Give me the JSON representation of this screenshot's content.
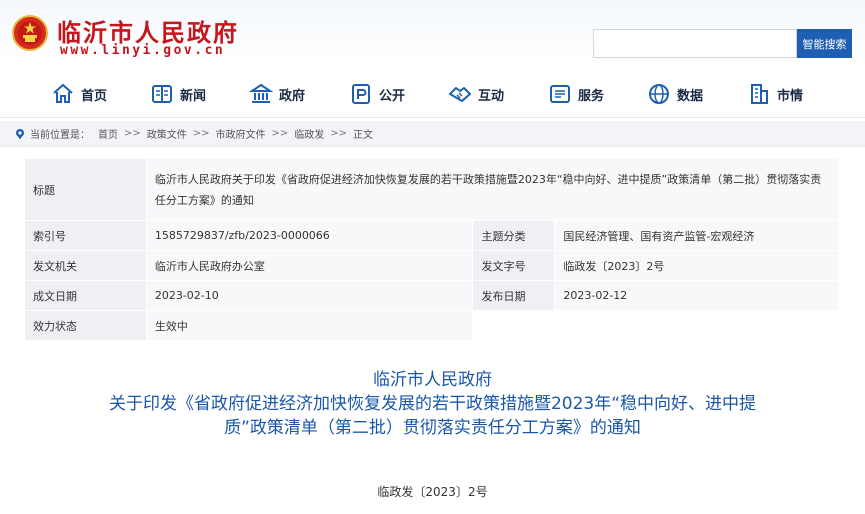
{
  "header": {
    "site_name": "临沂市人民政府",
    "site_url": "www.linyi.gov.cn",
    "search_placeholder": "",
    "search_button": "智能搜索",
    "brand_color": "#c4161c"
  },
  "nav": {
    "items": [
      {
        "label": "首页",
        "icon": "home-icon"
      },
      {
        "label": "新闻",
        "icon": "news-icon"
      },
      {
        "label": "政府",
        "icon": "government-building-icon"
      },
      {
        "label": "公开",
        "icon": "disclosure-icon"
      },
      {
        "label": "互动",
        "icon": "handshake-icon"
      },
      {
        "label": "服务",
        "icon": "service-list-icon"
      },
      {
        "label": "数据",
        "icon": "data-globe-icon"
      },
      {
        "label": "市情",
        "icon": "city-building-icon"
      }
    ]
  },
  "breadcrumb": {
    "prefix": "当前位置是：",
    "items": [
      "首页",
      "政策文件",
      "市政府文件",
      "临政发",
      "正文"
    ],
    "separator": ">>"
  },
  "info": {
    "title_label": "标题",
    "title_value": "临沂市人民政府关于印发《省政府促进经济加快恢复发展的若干政策措施暨2023年“稳中向好、进中提质”政策清单（第二批）贯彻落实责任分工方案》的通知",
    "index_label": "索引号",
    "index_value": "1585729837/zfb/2023-0000066",
    "topic_label": "主题分类",
    "topic_value": "国民经济管理、国有资产监管-宏观经济",
    "issuer_label": "发文机关",
    "issuer_value": "临沂市人民政府办公室",
    "docno_label": "发文字号",
    "docno_value": "临政发〔2023〕2号",
    "created_label": "成文日期",
    "created_value": "2023-02-10",
    "published_label": "发布日期",
    "published_value": "2023-02-12",
    "status_label": "效力状态",
    "status_value": "生效中"
  },
  "document": {
    "line1": "临沂市人民政府",
    "line2": "关于印发《省政府促进经济加快恢复发展的若干政策措施暨2023年“稳中向好、进中提",
    "line3": "质”政策清单（第二批）贯彻落实责任分工方案》的通知",
    "number": "临政发〔2023〕2号"
  }
}
